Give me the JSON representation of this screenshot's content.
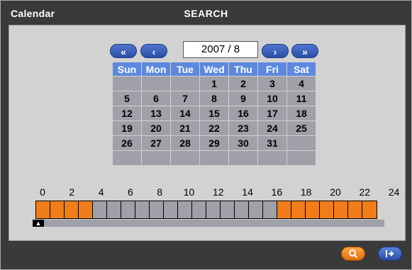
{
  "window": {
    "title_left": "Calendar",
    "title_center": "SEARCH"
  },
  "nav": {
    "prev_year": "«",
    "prev_month": "‹",
    "next_month": "›",
    "next_year": "»",
    "date_value": "2007 / 8"
  },
  "calendar": {
    "weekdays": [
      "Sun",
      "Mon",
      "Tue",
      "Wed",
      "Thu",
      "Fri",
      "Sat"
    ],
    "weeks": [
      [
        "",
        "",
        "",
        "1",
        "2",
        "3",
        "4"
      ],
      [
        "5",
        "6",
        "7",
        "8",
        "9",
        "10",
        "11"
      ],
      [
        "12",
        "13",
        "14",
        "15",
        "16",
        "17",
        "18"
      ],
      [
        "19",
        "20",
        "21",
        "22",
        "23",
        "24",
        "25"
      ],
      [
        "26",
        "27",
        "28",
        "29",
        "30",
        "31",
        ""
      ],
      [
        "",
        "",
        "",
        "",
        "",
        "",
        ""
      ]
    ]
  },
  "timeline": {
    "hour_labels": [
      "0",
      "2",
      "4",
      "6",
      "8",
      "10",
      "12",
      "14",
      "16",
      "18",
      "20",
      "22",
      "24"
    ],
    "recorded_hours": [
      true,
      true,
      true,
      true,
      false,
      false,
      false,
      false,
      false,
      false,
      false,
      false,
      false,
      false,
      false,
      false,
      false,
      true,
      true,
      true,
      true,
      true,
      true,
      true
    ]
  },
  "buttons": {
    "search_icon": "search-icon",
    "exit_icon": "exit-icon"
  },
  "colors": {
    "weekday_header": "#5d88df",
    "date_cell": "#9fa0a8",
    "recorded": "#f07d1a",
    "not_recorded": "#9fa0a8",
    "nav_button": "#3a62c0"
  }
}
